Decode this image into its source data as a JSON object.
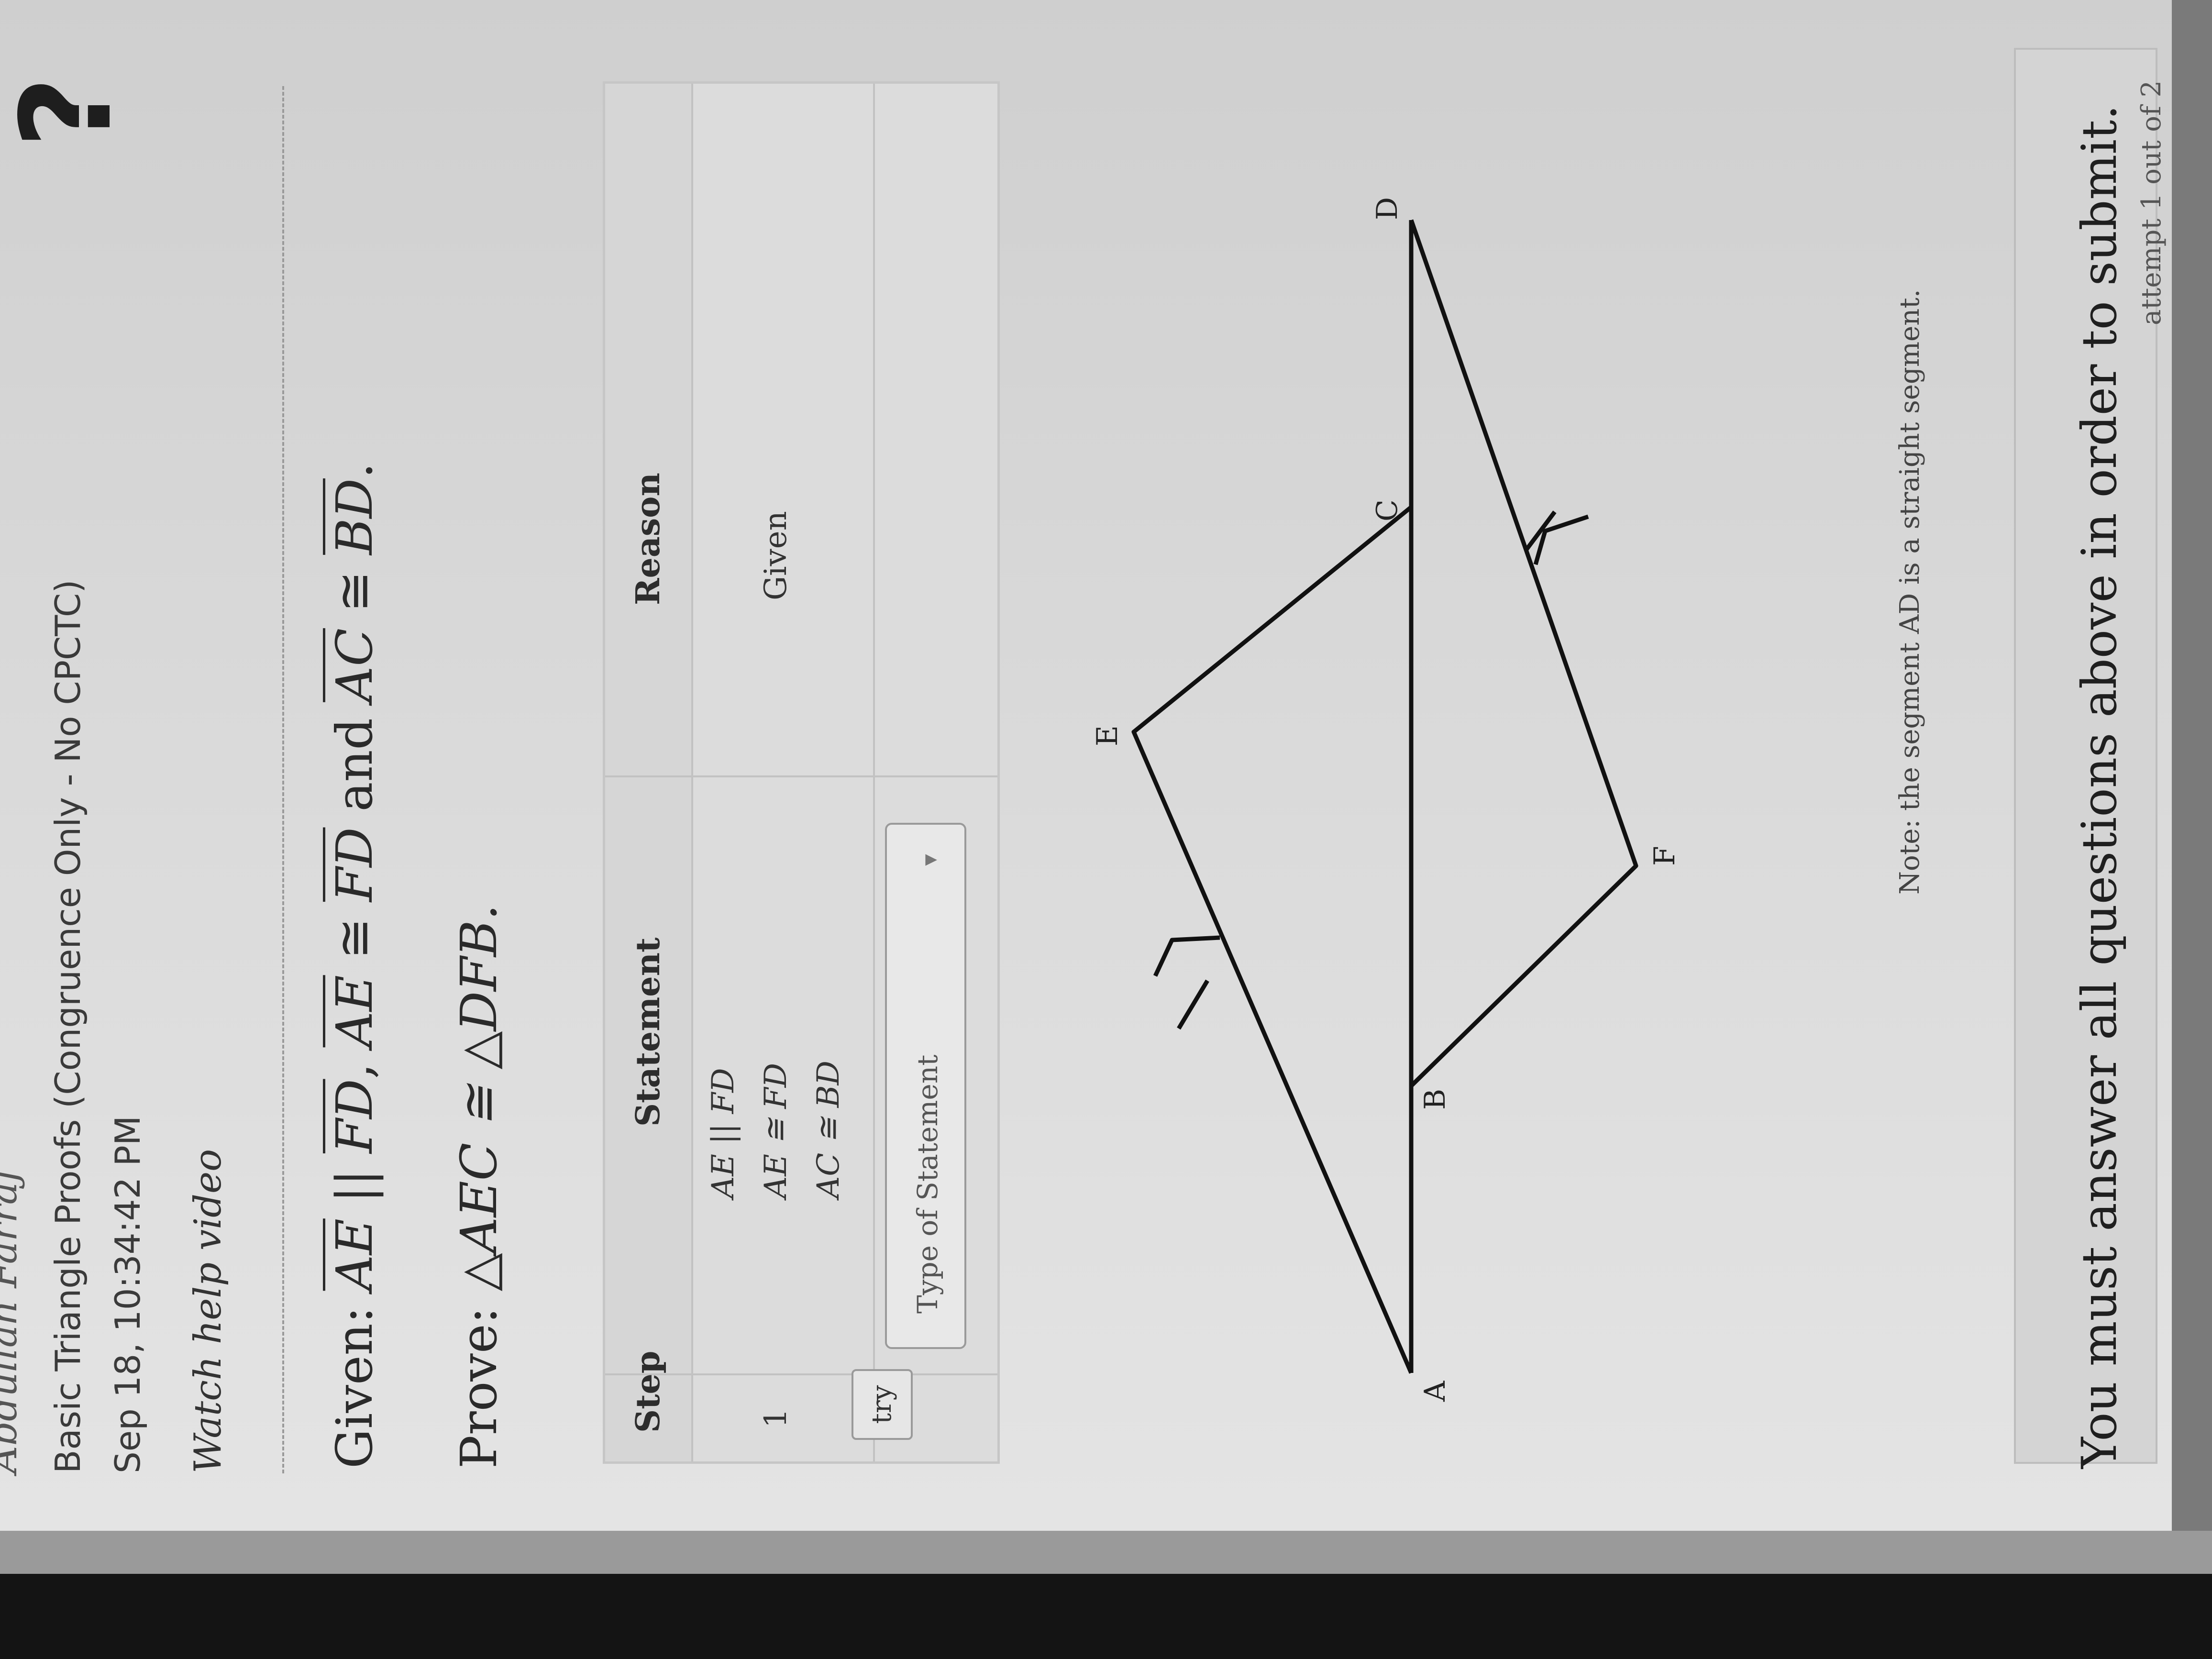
{
  "header": {
    "student_name": "Abdullah Farraj",
    "title": "Basic Triangle Proofs (Congruence Only - No CPCTC)",
    "timestamp": "Sep 18, 10:34:42 PM",
    "help_link": "Watch help video",
    "help_icon": "?"
  },
  "problem": {
    "given_label": "Given: ",
    "seg_ae": "AE",
    "seg_fd": "FD",
    "seg_ac": "AC",
    "seg_bd": "BD",
    "parallel": " || ",
    "congruent": " ≅ ",
    "comma": ", ",
    "and_word": " and ",
    "period": ".",
    "prove_label": "Prove: ",
    "prove_statement": "△AEC ≅ △DFB."
  },
  "proof_table": {
    "headers": {
      "step": "Step",
      "statement": "Statement",
      "reason": "Reason"
    },
    "rows": [
      {
        "step": "1",
        "statements": [
          "AE || FD",
          "AE ≅ FD",
          "AC ≅ BD"
        ],
        "reason": "Given"
      }
    ],
    "try_label": "try",
    "statement_placeholder": "Type of Statement"
  },
  "diagram": {
    "labels": {
      "A": "A",
      "B": "B",
      "C": "C",
      "D": "D",
      "E": "E",
      "F": "F"
    }
  },
  "note": "Note: the segment AD is a straight segment.",
  "footer": {
    "submit_message": "You must answer all questions above in order to submit.",
    "attempt": "attempt 1 out of 2"
  }
}
